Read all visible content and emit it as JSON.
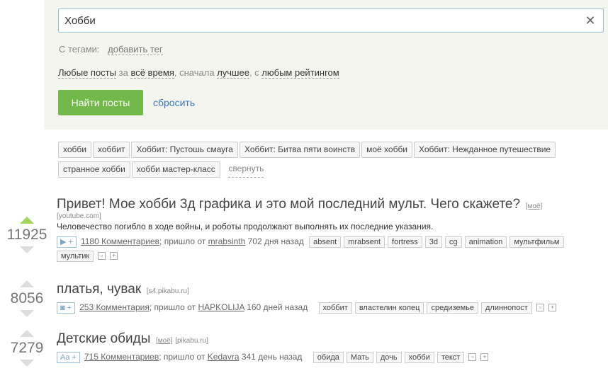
{
  "search": {
    "query": "Хобби",
    "clear_icon": "close-icon"
  },
  "tags_filter": {
    "label": "С тегами:",
    "add_tag": "добавить тег"
  },
  "filters": {
    "posts": "Любые посты",
    "for_word": "за",
    "period": "всё время",
    "first_word": ", сначала",
    "sort": "лучшее",
    "with_word": ", с",
    "rating": "любым рейтингом"
  },
  "actions": {
    "find": "Найти посты",
    "reset": "сбросить"
  },
  "related_tags": [
    "хобби",
    "хоббит",
    "Хоббит: Пустошь смауга",
    "Хоббит: Битва пяти воинств",
    "моё хобби",
    "Хоббит: Нежданное путешествие",
    "странное хобби",
    "хобби мастер-класс"
  ],
  "collapse_label": "свернуть",
  "posts": [
    {
      "rating": "11925",
      "upvoted": true,
      "title": "Привет! Мое хобби 3д графика и это мой последний мульт. Чего скажете?",
      "moe": "[моё]",
      "domain": "[youtube.com]",
      "description": "Человечество погибло в ходе войны, и роботы продолжают выполнять их последние указания.",
      "type_badge": "▶ +",
      "comments": "1180 Комментариев",
      "from_text": "; пришло от",
      "author": "mrabsinth",
      "age": "702 дня назад",
      "tags": [
        "absent",
        "mrabsent",
        "fortress",
        "3d",
        "cg",
        "animation",
        "мультфильм",
        "мультик"
      ]
    },
    {
      "rating": "8056",
      "upvoted": false,
      "title": "платья, чувак",
      "domain": "[s4.pikabu.ru]",
      "type_badge": "◙ +",
      "comments": "253 Комментария",
      "from_text": "; пришло от",
      "author": "HAPKOLIJA",
      "age": "160 дней назад",
      "tags": [
        "хоббит",
        "властелин колец",
        "средиземье",
        "длиннопост"
      ]
    },
    {
      "rating": "7279",
      "upvoted": false,
      "title": "Детские обиды",
      "moe": "[моё]",
      "domain": "[pikabu.ru]",
      "type_badge": "Aa +",
      "comments": "715 Комментариев",
      "from_text": "; пришло от",
      "author": "Kedavra",
      "age": "341 день назад",
      "tags": [
        "обида",
        "Мать",
        "дочь",
        "хобби",
        "текст"
      ]
    }
  ],
  "colors": {
    "panel_bg": "#f5f5f0",
    "find_button": "#72b84a",
    "link": "#3a78b8",
    "upvote_active": "#a3d45c"
  }
}
